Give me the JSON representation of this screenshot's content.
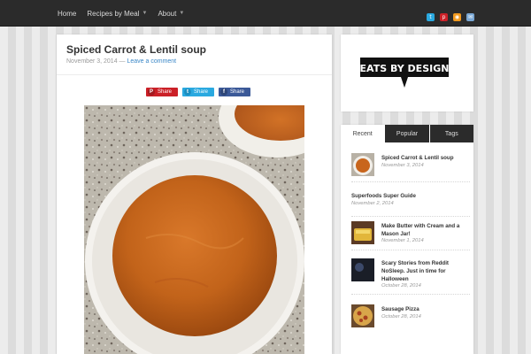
{
  "nav": {
    "items": [
      {
        "label": "Home",
        "has_dropdown": false
      },
      {
        "label": "Recipes by Meal",
        "has_dropdown": true
      },
      {
        "label": "About",
        "has_dropdown": true
      }
    ],
    "social_icons": [
      "twitter-icon",
      "pinterest-icon",
      "rss-icon",
      "email-icon"
    ]
  },
  "post": {
    "title": "Spiced Carrot & Lentil soup",
    "date": "November 3, 2014",
    "separator": " — ",
    "comment_link": "Leave a comment",
    "share_buttons": [
      {
        "label": "Share",
        "network": "pinterest",
        "color": "#cb2027"
      },
      {
        "label": "Share",
        "network": "twitter",
        "color": "#2aa9e0"
      },
      {
        "label": "Share",
        "network": "facebook",
        "color": "#3b5998"
      }
    ]
  },
  "logo": {
    "text": "EATS BY DESIGN"
  },
  "sidebar": {
    "tabs": [
      {
        "label": "Recent",
        "active": true
      },
      {
        "label": "Popular",
        "active": false
      },
      {
        "label": "Tags",
        "active": false
      }
    ],
    "items": [
      {
        "title": "Spiced Carrot & Lentil soup",
        "date": "November 3, 2014",
        "has_thumb": true
      },
      {
        "title": "Superfoods Super Guide",
        "date": "November 2, 2014",
        "has_thumb": false
      },
      {
        "title": "Make Butter with Cream and a Mason Jar!",
        "date": "November 1, 2014",
        "has_thumb": true
      },
      {
        "title": "Scary Stories from Reddit NoSleep. Just in time for Halloween",
        "date": "October 28, 2014",
        "has_thumb": true
      },
      {
        "title": "Sausage Pizza",
        "date": "October 28, 2014",
        "has_thumb": true
      }
    ]
  },
  "colors": {
    "topbar": "#2b2b2b",
    "link": "#3a87c7",
    "accent_soup": "#c96a1d"
  }
}
